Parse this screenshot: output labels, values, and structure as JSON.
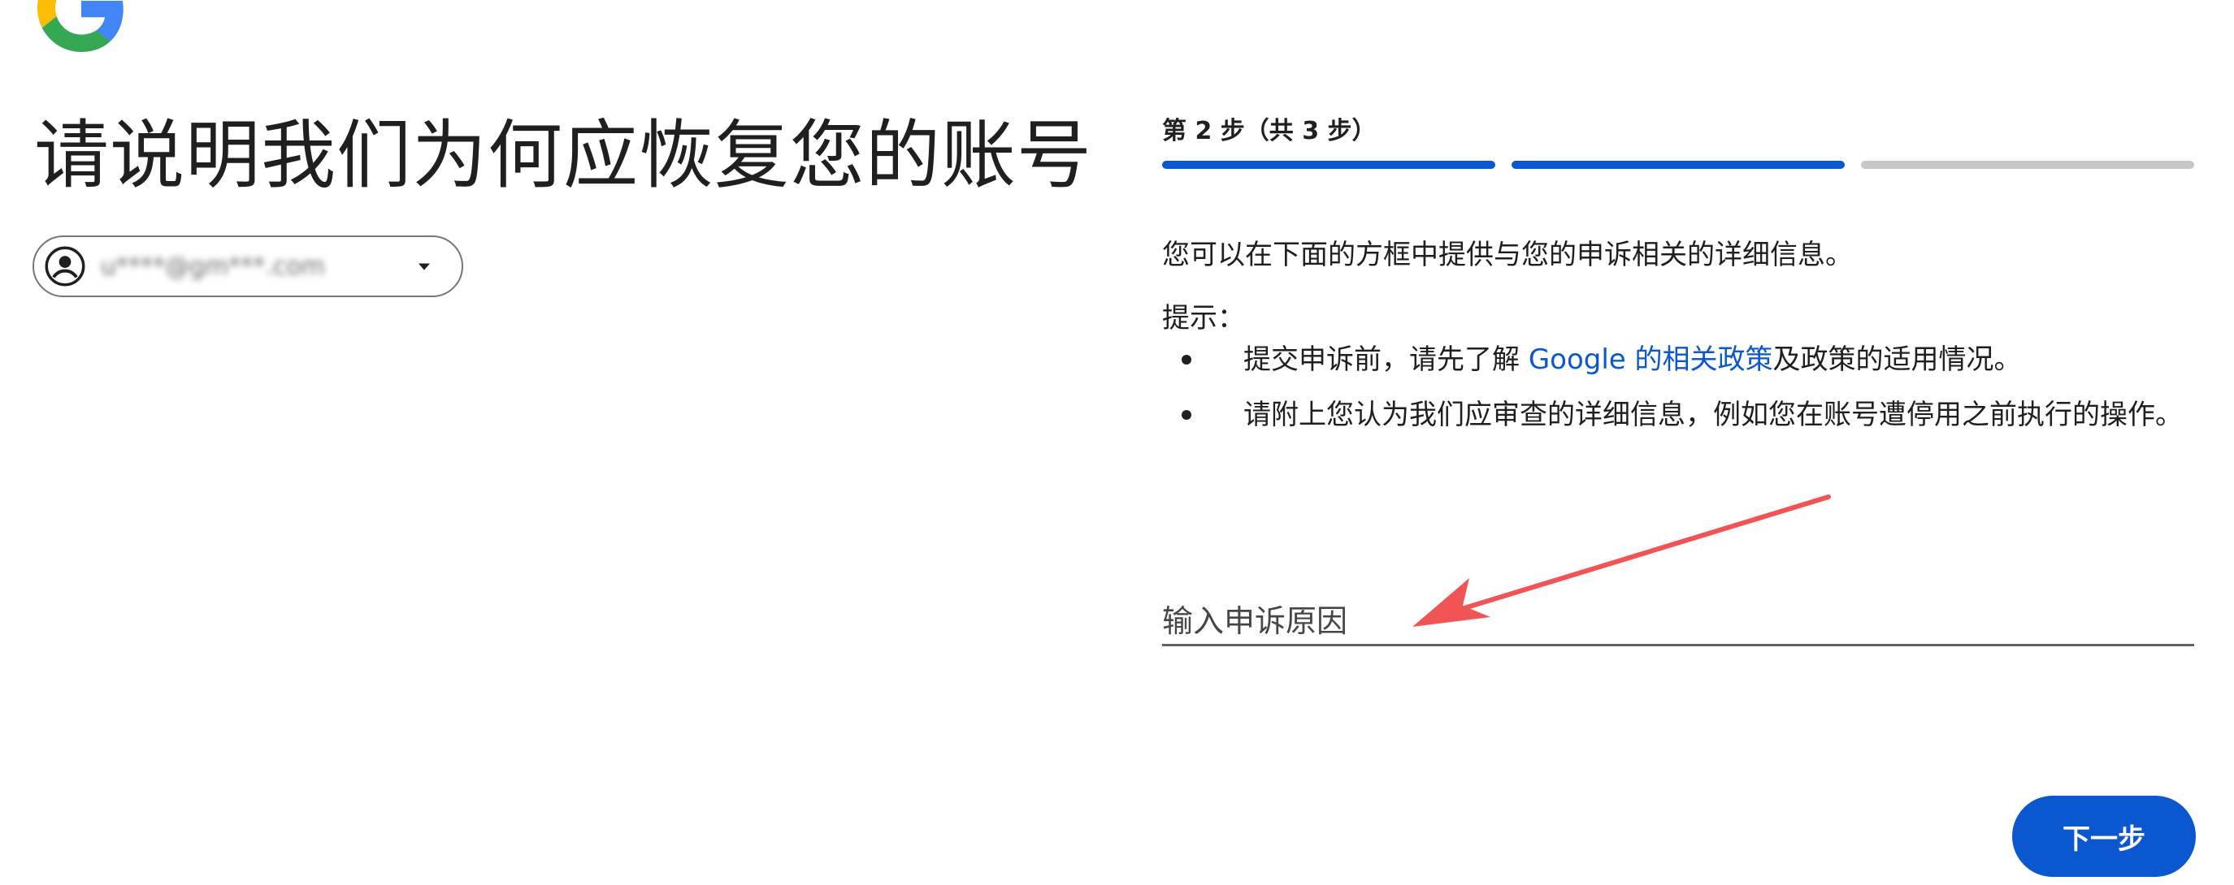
{
  "brand": {
    "logo": "google-g-logo"
  },
  "page": {
    "title": "请说明我们为何应恢复您的账号"
  },
  "account": {
    "email": "u****@gm***.com",
    "avatar_icon": "account-circle-icon",
    "dropdown_icon": "caret-down-icon"
  },
  "progress": {
    "label": "第 2 步（共 3 步）",
    "current_step": 2,
    "total_steps": 3
  },
  "form": {
    "description": "您可以在下面的方框中提供与您的申诉相关的详细信息。",
    "hints_title": "提示：",
    "hints": [
      {
        "before": "提交申诉前，请先了解 ",
        "link": "Google 的相关政策",
        "after": "及政策的适用情况。"
      },
      {
        "text": "请附上您认为我们应审查的详细信息，例如您在账号遭停用之前执行的操作。"
      }
    ],
    "reason_placeholder": "输入申诉原因",
    "reason_value": ""
  },
  "annotation": {
    "arrow_color": "#f05454"
  },
  "actions": {
    "next_label": "下一步"
  },
  "colors": {
    "primary": "#0b57d0",
    "progress_inactive": "#c7c7c7",
    "text": "#1f1f1f"
  }
}
